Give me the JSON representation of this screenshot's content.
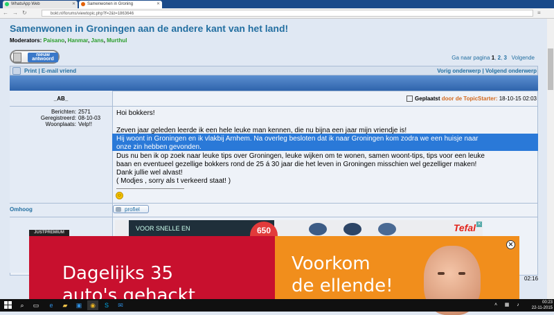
{
  "browser": {
    "tabs": [
      {
        "label": "WhatsApp Web",
        "favicon_color": "#25d366"
      },
      {
        "label": "Samenwonen in Groning",
        "favicon_color": "#e36209"
      }
    ],
    "url": "bokt.nl/forums/viewtopic.php?f=2&t=1863646"
  },
  "topic": {
    "title": "Samenwonen in Groningen aan de andere kant van het land!",
    "moderators_label": "Moderators:",
    "moderators": [
      "Paisano",
      "Hanmar",
      "Jans",
      "Murthul"
    ],
    "new_reply_label_1": "nieuw",
    "new_reply_label_2": "antwoord",
    "goto_page_label": "Ga naar pagina",
    "pages": [
      "1",
      "2",
      "3"
    ],
    "next_label": "Volgende",
    "print_label": "Print",
    "email_label": "E-mail vriend",
    "prev_topic": "Vorig onderwerp",
    "next_topic": "Volgend onderwerp"
  },
  "post": {
    "author": "_AB_",
    "stats": [
      {
        "label": "Berichten:",
        "value": "2571"
      },
      {
        "label": "Geregistreerd:",
        "value": "08-10-03"
      },
      {
        "label": "Woonplaats:",
        "value": "Velp!!"
      }
    ],
    "posted_label": "Geplaatst",
    "posted_by": "door de TopicStarter:",
    "posted_time": "18-10-15 02:03",
    "lines": [
      "Hoi bokkers!",
      "Zeven jaar geleden leerde ik een hele leuke man kennen, die nu bijna een jaar mijn vriendje is!",
      "Hij woont in Groningen en ik vlakbij Arnhem. Na overleg besloten dat ik naar Groningen kom zodra we een huisje naar",
      "onze zin hebben gevonden.",
      "Dus nu ben ik op zoek naar leuke tips over Groningen, leuke wijken om te wonen, samen woont-tips, tips voor een leuke",
      "baan en eventueel gezellige bokkers rond de 25 á 30 jaar die het leven in Groningen misschien wel gezelliger maken!",
      "Dank jullie wel alvast!",
      "( Modjes , sorry als t verkeerd staat! )"
    ],
    "up_label": "Omhoog",
    "profile_label": "profiel"
  },
  "ad": {
    "brand_tag": "JUSTPREMIUM",
    "strip_text": "VOOR SNELLE EN",
    "strip_number": "650",
    "strip_brand": "Tefal",
    "left_line1": "Dagelijks 35",
    "left_line2": "auto's gehackt",
    "right_line1": "Voorkom",
    "right_line2": "de ellende!",
    "close": "✕"
  },
  "clipped_time": "02:16",
  "taskbar": {
    "time": "00:23",
    "date": "22-11-2015"
  }
}
